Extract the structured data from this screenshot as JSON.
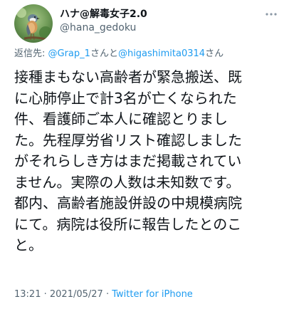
{
  "author": {
    "display_name": "ハナ@解毒女子2.0",
    "handle": "@hana_gedoku"
  },
  "more_icon": "more-horizontal-icon",
  "reply": {
    "prefix": "返信先: ",
    "mention1": "@Grap_1",
    "connector": "さんと",
    "mention2": "@higashimita0314",
    "suffix": "さん"
  },
  "body_lines": [
    "接種まもない高齢者が緊急搬送、既",
    "に心肺停止で計3名が亡くなられた",
    "件、看護師ご本人に確認とりまし",
    "た。先程厚労省リスト確認しました",
    "がそれらしき方はまだ掲載されてい",
    "ません。実際の人数は未知数です。",
    "都内、高齢者施設併設の中規模病院",
    "にて。病院は役所に報告したとのこ",
    "と。"
  ],
  "meta": {
    "time": "13:21",
    "separator1": " · ",
    "date": "2021/05/27",
    "separator2": " · ",
    "source": "Twitter for iPhone"
  },
  "colors": {
    "link": "#1d9bf0",
    "secondary": "#536471",
    "text": "#0f1419"
  }
}
